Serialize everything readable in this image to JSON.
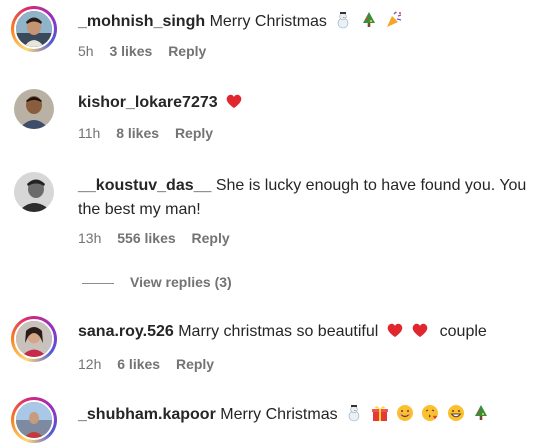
{
  "comments": [
    {
      "username": "_mohnish_singh",
      "text": "Merry Christmas",
      "emojis": [
        "snowman",
        "tree",
        "party-popper"
      ],
      "time": "5h",
      "likes": "3 likes",
      "reply": "Reply"
    },
    {
      "username": "kishor_lokare7273",
      "text": "",
      "emojis": [
        "heart"
      ],
      "time": "11h",
      "likes": "8 likes",
      "reply": "Reply"
    },
    {
      "username": "__koustuv_das__",
      "text": "She is lucky enough to have found you. You the best my man!",
      "emojis": [],
      "time": "13h",
      "likes": "556 likes",
      "reply": "Reply"
    },
    {
      "username": "sana.roy.526",
      "text": "Marry christmas so beautiful",
      "text_after": "couple",
      "emojis": [
        "heart",
        "heart"
      ],
      "time": "12h",
      "likes": "6 likes",
      "reply": "Reply"
    },
    {
      "username": "_shubham.kapoor",
      "text": "Merry Christmas",
      "emojis": [
        "snowman",
        "gift",
        "smile",
        "kiss",
        "grin",
        "tree"
      ],
      "time": "",
      "likes": "",
      "reply": ""
    }
  ],
  "view_replies": "View replies (3)",
  "colors": {
    "meta": "#737373",
    "heart": "#e0262f",
    "text": "#262626"
  }
}
